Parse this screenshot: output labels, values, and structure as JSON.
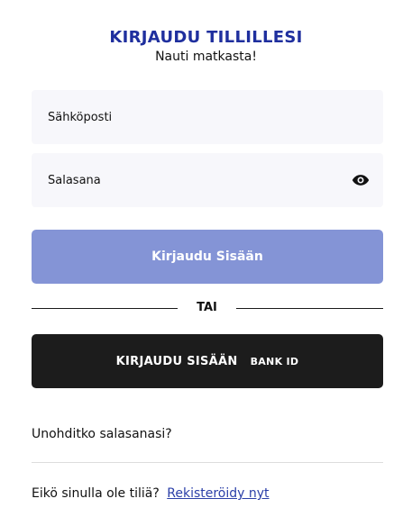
{
  "header": {
    "title": "KIRJAUDU TILLILLESI",
    "subtitle": "Nauti matkasta!"
  },
  "form": {
    "email_placeholder": "Sähköposti",
    "email_value": "",
    "password_placeholder": "Salasana",
    "password_value": "",
    "password_toggle_icon": "eye-icon",
    "login_button_label": "Kirjaudu Sisään"
  },
  "divider": {
    "label": "TAI"
  },
  "bankid": {
    "label": "KIRJAUDU SISÄÄN",
    "badge": "BANK ID"
  },
  "footer": {
    "forgot_password": "Unohditko salasanasi?",
    "no_account": "Eikö sinulla ole tiliä?",
    "register_link": "Rekisteröidy nyt"
  },
  "colors": {
    "title": "#1f2f9e",
    "login_button": "#8494d6",
    "bankid_button": "#1c1c1c",
    "link": "#2b3fa8",
    "field_bg": "#f7f7fb"
  }
}
